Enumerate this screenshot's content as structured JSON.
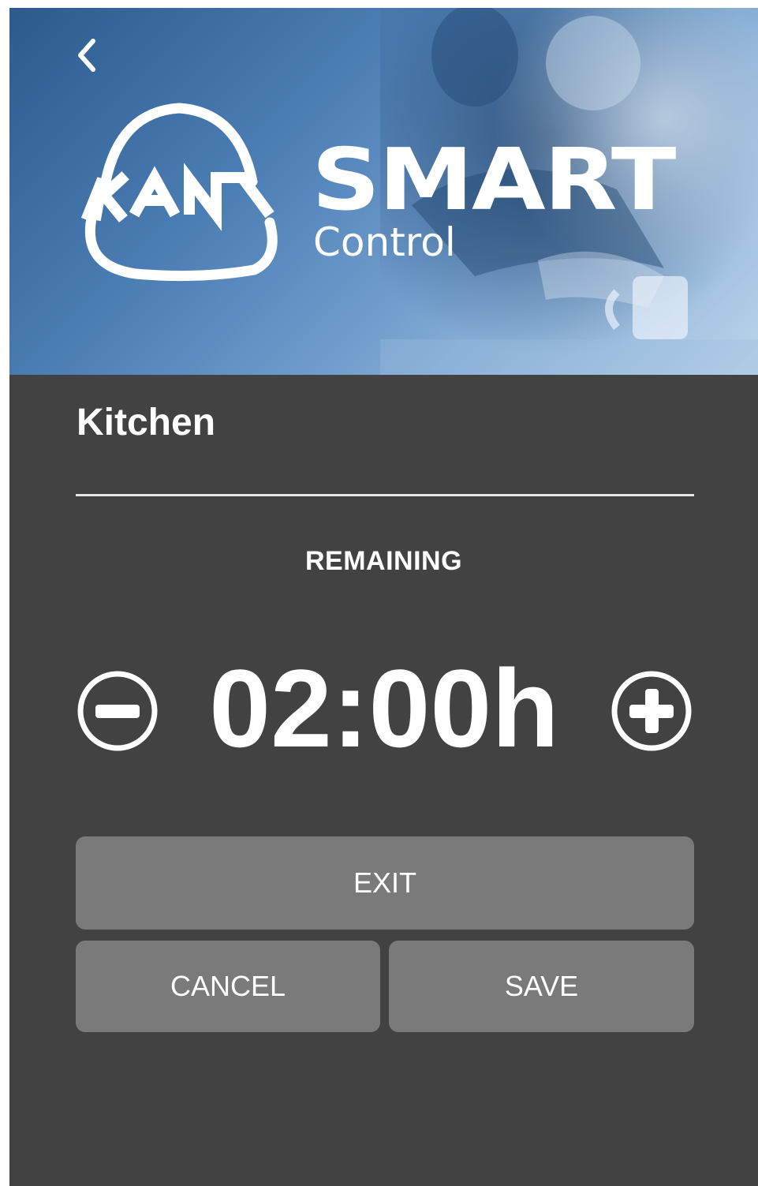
{
  "header": {
    "brand_main": "SMART",
    "brand_sub": "Control",
    "logo_icon": "kan-logo-icon",
    "back_icon": "chevron-left-icon",
    "colors": {
      "banner_dark": "#2c5a8c",
      "banner_light": "#bcd4ea"
    }
  },
  "room": {
    "title": "Kitchen"
  },
  "timer": {
    "label": "REMAINING",
    "value": "02:00h",
    "decrease_icon": "minus-circle-icon",
    "increase_icon": "plus-circle-icon"
  },
  "actions": {
    "exit_label": "EXIT",
    "cancel_label": "CANCEL",
    "save_label": "SAVE",
    "button_color": "#7a7a7a"
  },
  "theme": {
    "background": "#424242",
    "text": "#ffffff"
  }
}
